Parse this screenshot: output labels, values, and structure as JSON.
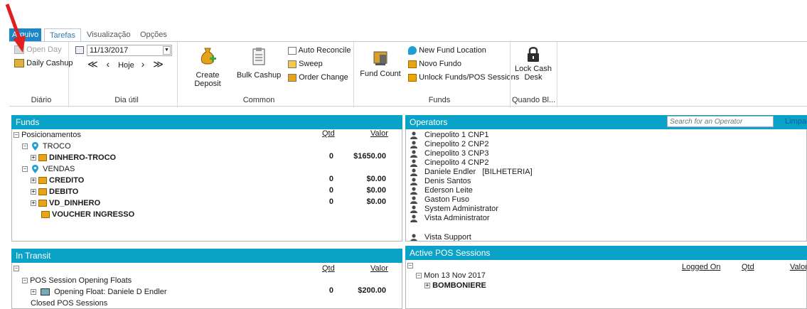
{
  "tabs": {
    "file": "Arquivo",
    "tarefas": "Tarefas",
    "visualizacao": "Visualização",
    "opcoes": "Opções"
  },
  "ribbon": {
    "diario": {
      "open_day": "Open Day",
      "daily_cashup": "Daily Cashup",
      "label": "Diário"
    },
    "dia_util": {
      "date": "11/13/2017",
      "hoje": "Hoje",
      "label": "Dia útil"
    },
    "common": {
      "create_deposit": "Create Deposit",
      "bulk_cashup": "Bulk Cashup",
      "auto_reconcile": "Auto Reconcile",
      "sweep": "Sweep",
      "order_change": "Order Change",
      "label": "Common"
    },
    "funds": {
      "fund_count": "Fund Count",
      "new_fund_location": "New Fund Location",
      "novo_fundo": "Novo Fundo",
      "unlock": "Unlock Funds/POS Sessions",
      "label": "Funds"
    },
    "lock": {
      "lock_cash_desk_1": "Lock Cash",
      "lock_cash_desk_2": "Desk",
      "label": "Quando Bl..."
    }
  },
  "funds_panel": {
    "title": "Funds",
    "root": "Posicionamentos",
    "qtd_header": "Qtd",
    "valor_header": "Valor",
    "troco": "TROCO",
    "dinheiro_troco": {
      "name": "DINHERO-TROCO",
      "qtd": "0",
      "valor": "$1650.00"
    },
    "vendas": "VENDAS",
    "credito": {
      "name": "CREDITO",
      "qtd": "0",
      "valor": "$0.00"
    },
    "debito": {
      "name": "DEBITO",
      "qtd": "0",
      "valor": "$0.00"
    },
    "vd_dinheiro": {
      "name": "VD_DINHERO",
      "qtd": "0",
      "valor": "$0.00"
    },
    "voucher": "VOUCHER INGRESSO"
  },
  "operators_panel": {
    "title": "Operators",
    "search_placeholder": "Search for an Operator",
    "clear": "Limpar",
    "items": [
      "Cinepolito 1 CNP1",
      "Cinepolito 2 CNP2",
      "Cinepolito 3 CNP3",
      "Cinepolito 4 CNP2",
      "Daniele Endler   [BILHETERIA]",
      "Denis Santos",
      "Ederson Leite",
      "Gaston Fuso",
      "System Administrator",
      "Vista Administrator",
      "Vista Support"
    ]
  },
  "in_transit_panel": {
    "title": "In Transit",
    "qtd_header": "Qtd",
    "valor_header": "Valor",
    "opening_floats": "POS Session Opening Floats",
    "opening_float": {
      "name": "Opening Float: Daniele D Endler",
      "qtd": "0",
      "valor": "$200.00"
    },
    "closed_sessions": "Closed POS Sessions"
  },
  "active_pos_panel": {
    "title": "Active POS Sessions",
    "logged_on_header": "Logged On",
    "qtd_header": "Qtd",
    "valor_header": "Valor",
    "date_node": "Mon 13 Nov 2017",
    "bomboniere": "BOMBONIERE"
  },
  "colors": {
    "panel_header": "#0aa2c6",
    "file_tab": "#1c86c7",
    "arrow": "#e02020"
  }
}
